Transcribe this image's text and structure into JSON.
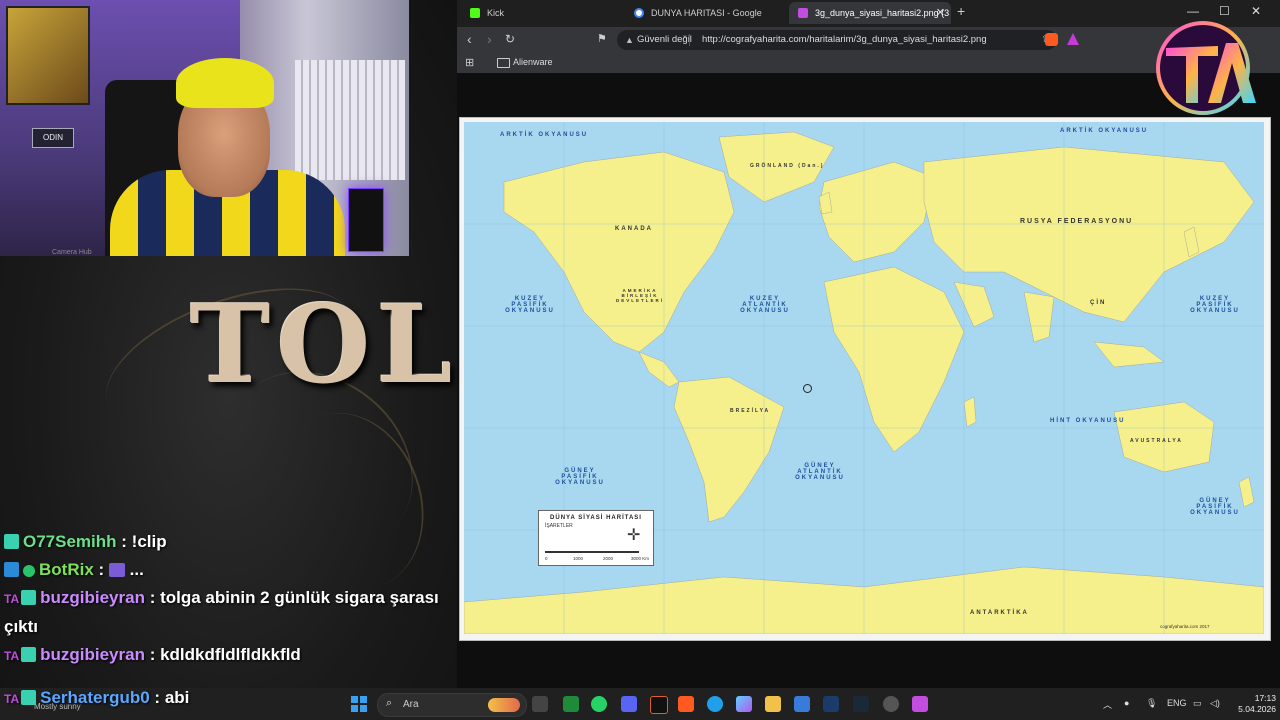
{
  "stream": {
    "webcam_caption": "Camera Hub",
    "sign_text": "ODIN",
    "logo_text": "TOL"
  },
  "chat": {
    "messages": [
      {
        "user": "O77Semihh",
        "text": "!clip"
      },
      {
        "user": "BotRix",
        "text": "..."
      },
      {
        "user": "buzgibieyran",
        "text": "tolga abinin 2 günlük sigara şarası çıktı"
      },
      {
        "user": "buzgibieyran",
        "text": "kdldkdfldlfldkkfld"
      },
      {
        "user": "Serhatergub0",
        "text": "abi"
      }
    ]
  },
  "browser": {
    "tabs": [
      {
        "label": "Kick",
        "color": "#53fc18"
      },
      {
        "label": "DUNYA HARITASI - Google Search",
        "color": "#4285f4"
      },
      {
        "label": "3g_dunya_siyasi_haritasi2.png (3",
        "color": "#c24de0"
      }
    ],
    "window_controls": {
      "minimize": "—",
      "maximize": "☐",
      "close": "✕"
    },
    "security_label": "Güvenli değil",
    "url": "http://cografyaharita.com/haritalarim/3g_dunya_siyasi_haritasi2.png",
    "bookmark_label": "Alienware"
  },
  "map": {
    "oceans": {
      "arctic_left": "ARKTİK OKYANUSU",
      "arctic_right": "ARKTİK OKYANUSU",
      "north_pacific_left": "KUZEY PASİFİK OKYANUSU",
      "north_atlantic": "KUZEY ATLANTİK OKYANUSU",
      "north_pacific_right": "KUZEY PASİFİK OKYANUSU",
      "south_pacific_left": "GÜNEY PASİFİK OKYANUSU",
      "south_atlantic": "GÜNEY ATLANTİK OKYANUSU",
      "indian": "HİNT OKYANUSU",
      "south_pacific_right": "GÜNEY PASİFİK OKYANUSU"
    },
    "countries": {
      "greenland": "GRÖNLAND (Dan.)",
      "canada": "KANADA",
      "usa": "AMERİKA BİRLEŞİK DEVLETLERİ",
      "russia": "RUSYA FEDERASYONU",
      "china": "ÇİN",
      "brazil": "BREZİLYA",
      "australia": "AVUSTRALYA",
      "antarctica": "ANTARKTİKA"
    },
    "legend": {
      "title": "DÜNYA SİYASİ HARİTASI",
      "subtitle": "İŞARETLER",
      "scale_labels": [
        "0",
        "1000",
        "2000",
        "3000 Km"
      ]
    },
    "credit": "cografyaharita.com 2017"
  },
  "taskbar": {
    "weather": "Mostly sunny",
    "search_placeholder": "Ara",
    "language": "ENG",
    "time": "17:13",
    "date": "5.04.2026"
  }
}
